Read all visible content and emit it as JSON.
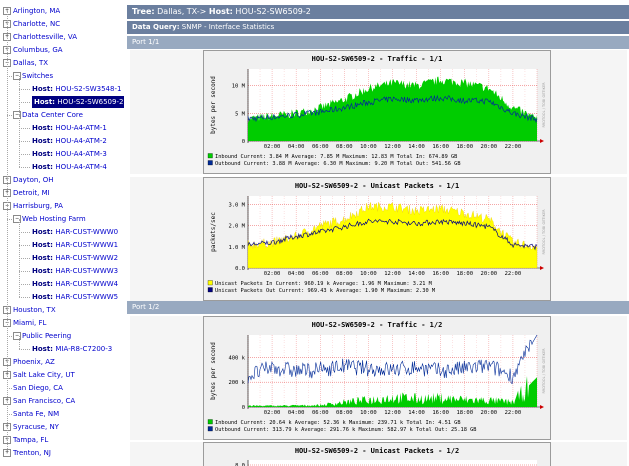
{
  "tree": [
    {
      "type": "site",
      "label": "Arlington, MA",
      "toggle": "+"
    },
    {
      "type": "site",
      "label": "Charlotte, NC",
      "toggle": "+"
    },
    {
      "type": "site",
      "label": "Charlottesville, VA",
      "toggle": "+"
    },
    {
      "type": "site",
      "label": "Columbus, GA",
      "toggle": "+"
    },
    {
      "type": "site",
      "label": "Dallas, TX",
      "toggle": "−"
    },
    {
      "type": "group",
      "label": "Switches",
      "toggle": "−"
    },
    {
      "type": "host",
      "prefix": "Host:",
      "label": "HOU-S2-SW3548-1"
    },
    {
      "type": "host",
      "prefix": "Host:",
      "label": "HOU-S2-SW6509-2",
      "selected": true
    },
    {
      "type": "group",
      "label": "Data Center Core",
      "toggle": "−"
    },
    {
      "type": "host",
      "prefix": "Host:",
      "label": "HOU-A4-ATM-1"
    },
    {
      "type": "host",
      "prefix": "Host:",
      "label": "HOU-A4-ATM-2"
    },
    {
      "type": "host",
      "prefix": "Host:",
      "label": "HOU-A4-ATM-3"
    },
    {
      "type": "host",
      "prefix": "Host:",
      "label": "HOU-A4-ATM-4"
    },
    {
      "type": "site",
      "label": "Dayton, OH",
      "toggle": "+"
    },
    {
      "type": "site",
      "label": "Detroit, MI",
      "toggle": "+"
    },
    {
      "type": "site",
      "label": "Harrisburg, PA",
      "toggle": "−"
    },
    {
      "type": "group",
      "label": "Web Hosting Farm",
      "toggle": "−"
    },
    {
      "type": "host",
      "prefix": "Host:",
      "label": "HAR-CUST-WWW0"
    },
    {
      "type": "host",
      "prefix": "Host:",
      "label": "HAR-CUST-WWW1"
    },
    {
      "type": "host",
      "prefix": "Host:",
      "label": "HAR-CUST-WWW2"
    },
    {
      "type": "host",
      "prefix": "Host:",
      "label": "HAR-CUST-WWW3"
    },
    {
      "type": "host",
      "prefix": "Host:",
      "label": "HAR-CUST-WWW4"
    },
    {
      "type": "host",
      "prefix": "Host:",
      "label": "HAR-CUST-WWW5"
    },
    {
      "type": "site",
      "label": "Houston, TX",
      "toggle": "+"
    },
    {
      "type": "site",
      "label": "Miami, FL",
      "toggle": "−"
    },
    {
      "type": "group",
      "label": "Public Peering",
      "toggle": "−"
    },
    {
      "type": "host",
      "prefix": "Host:",
      "label": "MIA-R8-C7200-3"
    },
    {
      "type": "site",
      "label": "Phoenix, AZ",
      "toggle": "+"
    },
    {
      "type": "site",
      "label": "Salt Lake City, UT",
      "toggle": "+"
    },
    {
      "type": "site",
      "label": "San Diego, CA"
    },
    {
      "type": "site",
      "label": "San Francisco, CA",
      "toggle": "+"
    },
    {
      "type": "site",
      "label": "Santa Fe, NM"
    },
    {
      "type": "site",
      "label": "Syracuse, NY",
      "toggle": "+"
    },
    {
      "type": "site",
      "label": "Tampa, FL",
      "toggle": "+"
    },
    {
      "type": "site",
      "label": "Trenton, NJ",
      "toggle": "+"
    }
  ],
  "header": {
    "tree_label": "Tree:",
    "tree_path": "Dallas, TX-> ",
    "host_label": "Host:",
    "host_name": "HOU-S2-SW6509-2",
    "query_label": "Data Query:",
    "query_value": "SNMP - Interface Statistics"
  },
  "ports": [
    "Port 1/1",
    "Port 1/2"
  ],
  "colors": {
    "inbound": "#00cc00",
    "outbound": "#002a97",
    "unicast_in": "#ffff00",
    "unicast_in_edge": "#e4c000",
    "unicast_out": "#000080",
    "grid": "#e00000",
    "tree_link": "#0000cc",
    "header_bar": "#6b7f9f",
    "sub_bar": "#98a9c0"
  },
  "time_ticks": [
    "02:00",
    "04:00",
    "06:00",
    "08:00",
    "10:00",
    "12:00",
    "14:00",
    "16:00",
    "18:00",
    "20:00",
    "22:00"
  ],
  "side_label": "RRDTOOL / TOBI OETIKER",
  "graphs": [
    {
      "title": "HOU-S2-SW6509-2 - Traffic - 1/1",
      "ylabel": "bytes per second",
      "yticks": [
        "10 M",
        "5 M",
        "0"
      ],
      "legend": [
        {
          "swatch": "inbound",
          "name": "Inbound ",
          "text": "Current:     3.84 M  Average:     7.85 M  Maximum:    12.83 M  Total In:   674.89 GB"
        },
        {
          "swatch": "outbound",
          "name": "Outbound",
          "text": "Current:     3.88 M  Average:     6.30 M  Maximum:     9.20 M  Total Out:  541.56 GB"
        }
      ],
      "chart_data": {
        "type": "area",
        "x": [
          "00:00",
          "02:00",
          "04:00",
          "06:00",
          "08:00",
          "10:00",
          "12:00",
          "14:00",
          "16:00",
          "18:00",
          "20:00",
          "22:00",
          "24:00"
        ],
        "ylim": [
          0,
          13
        ],
        "series": [
          {
            "name": "Inbound",
            "values": [
              4.0,
              4.5,
              5.0,
              6.0,
              7.5,
              9.5,
              10.5,
              10.0,
              11.0,
              10.5,
              9.5,
              6.0,
              4.0
            ]
          },
          {
            "name": "Outbound",
            "values": [
              4.0,
              4.3,
              4.7,
              5.2,
              6.0,
              7.0,
              7.6,
              7.4,
              7.8,
              7.3,
              7.2,
              5.0,
              3.9
            ]
          }
        ]
      }
    },
    {
      "title": "HOU-S2-SW6509-2 - Unicast Packets - 1/1",
      "ylabel": "packets/sec",
      "yticks": [
        "3.0 M",
        "2.0 M",
        "1.0 M",
        "0.0"
      ],
      "legend": [
        {
          "swatch": "unicast_in",
          "name": "Unicast Packets In ",
          "text": "Current:   960.19 k  Average:     1.96 M  Maximum:     3.21 M"
        },
        {
          "swatch": "unicast_out",
          "name": "Unicast Packets Out",
          "text": "Current:   969.43 k  Average:     1.90 M  Maximum:     2.30 M"
        }
      ],
      "chart_data": {
        "type": "area",
        "x": [
          "00:00",
          "02:00",
          "04:00",
          "06:00",
          "08:00",
          "10:00",
          "12:00",
          "14:00",
          "16:00",
          "18:00",
          "20:00",
          "22:00",
          "24:00"
        ],
        "ylim": [
          0,
          3.4
        ],
        "series": [
          {
            "name": "Unicast Packets In",
            "values": [
              1.1,
              1.2,
              1.5,
              2.0,
              2.3,
              2.9,
              2.9,
              2.7,
              2.8,
              2.6,
              2.3,
              1.2,
              1.0
            ]
          },
          {
            "name": "Unicast Packets Out",
            "values": [
              1.1,
              1.2,
              1.5,
              1.7,
              1.95,
              2.2,
              2.2,
              2.1,
              2.2,
              2.1,
              1.95,
              1.1,
              1.0
            ]
          }
        ]
      }
    },
    {
      "title": "HOU-S2-SW6509-2 - Traffic - 1/2",
      "ylabel": "bytes per second",
      "yticks": [
        "400 k",
        "200 k",
        "0"
      ],
      "legend": [
        {
          "swatch": "inbound",
          "name": "Inbound ",
          "text": "Current:    20.64 k  Average:    52.36 k  Maximum:   239.71 k  Total In:     4.51 GB"
        },
        {
          "swatch": "outbound",
          "name": "Outbound",
          "text": "Current:   313.79 k  Average:   291.76 k  Maximum:   582.97 k  Total Out:   25.18 GB"
        }
      ],
      "chart_data": {
        "type": "line",
        "x": [
          "00:00",
          "02:00",
          "04:00",
          "06:00",
          "08:00",
          "10:00",
          "12:00",
          "14:00",
          "16:00",
          "18:00",
          "20:00",
          "22:00",
          "24:00"
        ],
        "ylim": [
          0,
          580
        ],
        "series": [
          {
            "name": "Inbound",
            "values": [
              10,
              10,
              12,
              15,
              40,
              60,
              80,
              70,
              75,
              60,
              55,
              40,
              240
            ]
          },
          {
            "name": "Outbound",
            "values": [
              250,
              320,
              290,
              300,
              330,
              310,
              300,
              320,
              290,
              310,
              330,
              250,
              580
            ]
          }
        ]
      }
    },
    {
      "title": "HOU-S2-SW6509-2 - Unicast Packets - 1/2",
      "yticks": [
        "8.0"
      ]
    }
  ]
}
